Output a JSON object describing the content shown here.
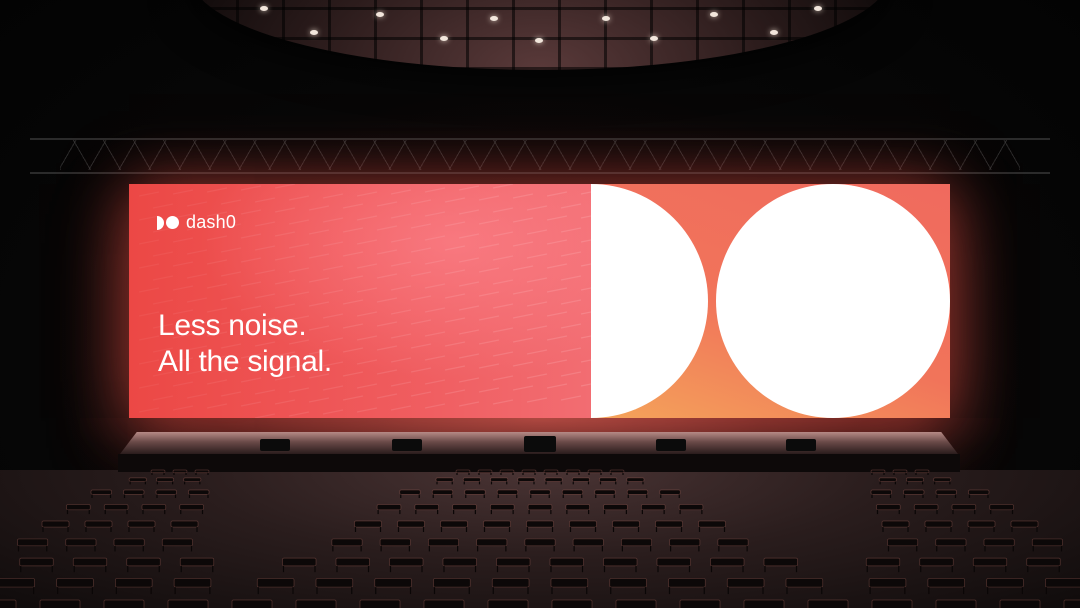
{
  "screen": {
    "logo_text": "dash0",
    "headline_line1": "Less noise.",
    "headline_line2": "All the signal."
  },
  "colors": {
    "brand_red": "#ec4845",
    "brand_orange": "#f4a45a",
    "white": "#ffffff"
  }
}
